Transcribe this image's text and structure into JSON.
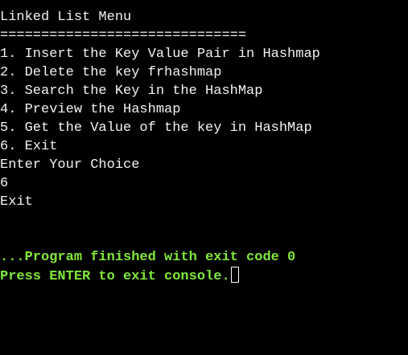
{
  "console": {
    "menu_title": "Linked List Menu",
    "separator": "==============================",
    "options": [
      "1. Insert the Key Value Pair in Hashmap",
      "2. Delete the key frhashmap",
      "3. Search the Key in the HashMap",
      "4. Preview the Hashmap",
      "5. Get the Value of the key in HashMap",
      "6. Exit"
    ],
    "prompt": "Enter Your Choice",
    "user_input": "6",
    "result": "Exit",
    "finish_message": "...Program finished with exit code 0",
    "exit_prompt": "Press ENTER to exit console.",
    "colors": {
      "background": "#000000",
      "text": "#f2f2f2",
      "status": "#80e83a"
    },
    "cursor_icon": "block-cursor-icon"
  }
}
